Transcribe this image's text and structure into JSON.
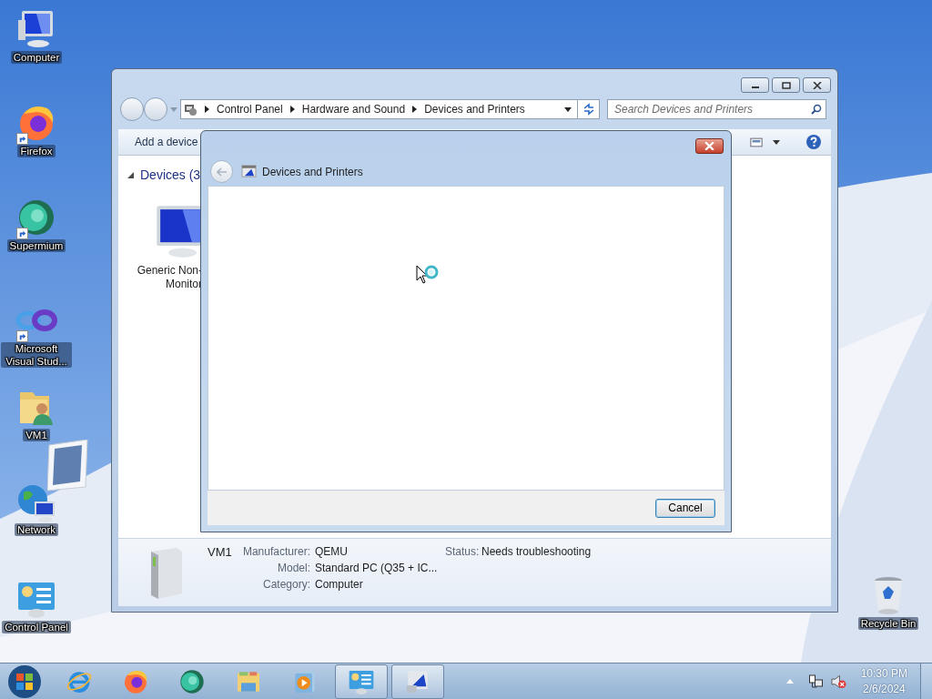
{
  "desktop": {
    "icons": [
      {
        "label": "Computer",
        "kind": "computer",
        "shortcut": false
      },
      {
        "label": "Firefox",
        "kind": "firefox",
        "shortcut": true
      },
      {
        "label": "Supermium",
        "kind": "supermium",
        "shortcut": true
      },
      {
        "label": "Microsoft Visual Stud...",
        "kind": "vs",
        "shortcut": true
      },
      {
        "label": "VM1",
        "kind": "user-folder",
        "shortcut": false
      },
      {
        "label": "Network",
        "kind": "network",
        "shortcut": false
      },
      {
        "label": "Control Panel",
        "kind": "control-panel",
        "shortcut": false
      },
      {
        "label": "Recycle Bin",
        "kind": "recycle-bin",
        "shortcut": false
      }
    ]
  },
  "explorer": {
    "address": [
      "Control Panel",
      "Hardware and Sound",
      "Devices and Printers"
    ],
    "search": {
      "placeholder": "Search Devices and Printers"
    },
    "commands": [
      {
        "label": "Add a device"
      }
    ],
    "group": {
      "title": "Devices (3",
      "expanded": true
    },
    "devices": [
      {
        "kind": "monitor",
        "lines": [
          "Generic Non-",
          "Monitor"
        ]
      }
    ],
    "details": {
      "name": "VM1",
      "fields": [
        {
          "label": "Manufacturer:",
          "value": "QEMU"
        },
        {
          "label": "Model:",
          "value": "Standard PC (Q35 + IC..."
        },
        {
          "label": "Category:",
          "value": "Computer"
        }
      ],
      "status": {
        "label": "Status:",
        "value": "Needs troubleshooting"
      }
    }
  },
  "dialog": {
    "title": "Devices and Printers",
    "busy": true,
    "buttons": [
      {
        "label": "Cancel",
        "default": true
      }
    ]
  },
  "taskbar": {
    "items": [
      {
        "kind": "ie",
        "running": false
      },
      {
        "kind": "firefox",
        "running": false
      },
      {
        "kind": "supermium",
        "running": false
      },
      {
        "kind": "explorer",
        "running": false
      },
      {
        "kind": "media",
        "running": false
      },
      {
        "kind": "control-panel",
        "running": true
      },
      {
        "kind": "devices",
        "running": true
      }
    ]
  },
  "tray": {
    "sound_muted": true,
    "time": "10:30 PM",
    "date": "2/6/2024"
  }
}
